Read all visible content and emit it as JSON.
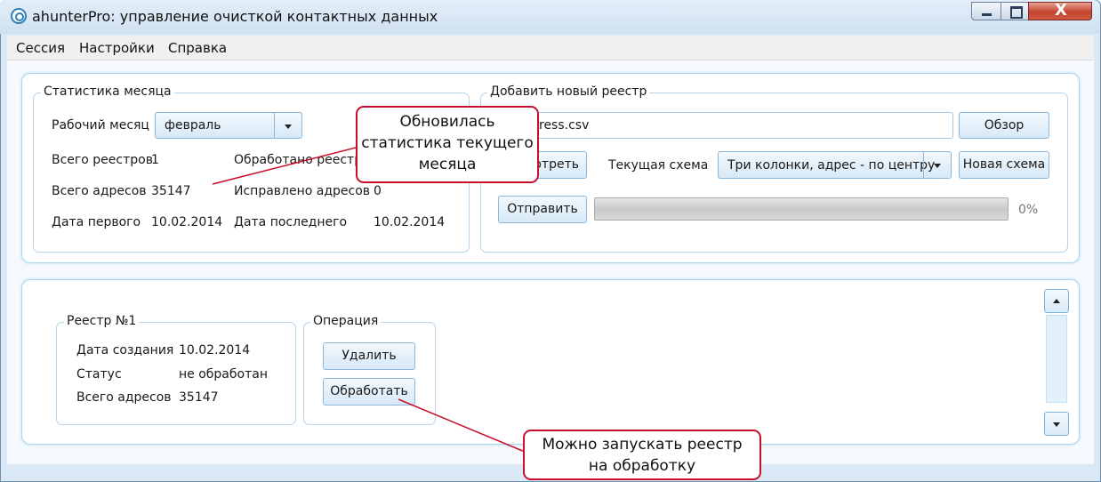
{
  "window": {
    "title": "ahunterPro: управление очисткой контактных данных",
    "close_glyph": "X"
  },
  "menu": [
    "Сессия",
    "Настройки",
    "Справка"
  ],
  "stats": {
    "legend": "Статистика месяца",
    "month_label": "Рабочий месяц",
    "month_value": "февраль",
    "total_registries_label": "Всего реестров",
    "total_registries_value": "1",
    "processed_label": "Обработано реестров",
    "total_addresses_label": "Всего адресов",
    "total_addresses_value": "35147",
    "fixed_label": "Исправлено адресов",
    "fixed_value": "0",
    "first_date_label": "Дата первого",
    "first_date_value": "10.02.2014",
    "last_date_label": "Дата последнего",
    "last_date_value": "10.02.2014"
  },
  "add": {
    "legend": "Добавить новый реестр",
    "file_value": "ress.csv",
    "browse": "Обзор",
    "view": "отреть",
    "scheme_label": "Текущая схема",
    "scheme_value": "Три колонки, адрес - по центру",
    "new_scheme": "Новая схема",
    "send": "Отправить",
    "progress": 0,
    "progress_text": "0%"
  },
  "registry": {
    "legend": "Реестр №1",
    "created_label": "Дата создания",
    "created_value": "10.02.2014",
    "status_label": "Статус",
    "status_value": "не обработан",
    "total_label": "Всего адресов",
    "total_value": "35147"
  },
  "operation": {
    "legend": "Операция",
    "delete": "Удалить",
    "process": "Обработать"
  },
  "callouts": {
    "top": [
      "Обновилась",
      "статистика текущего",
      "месяца"
    ],
    "bottom": [
      "Можно запускать реестр",
      "на обработку"
    ]
  },
  "colors": {
    "accent": "#a9d3ee",
    "callout_border": "#c8102e",
    "close_button": "#c4432f"
  }
}
